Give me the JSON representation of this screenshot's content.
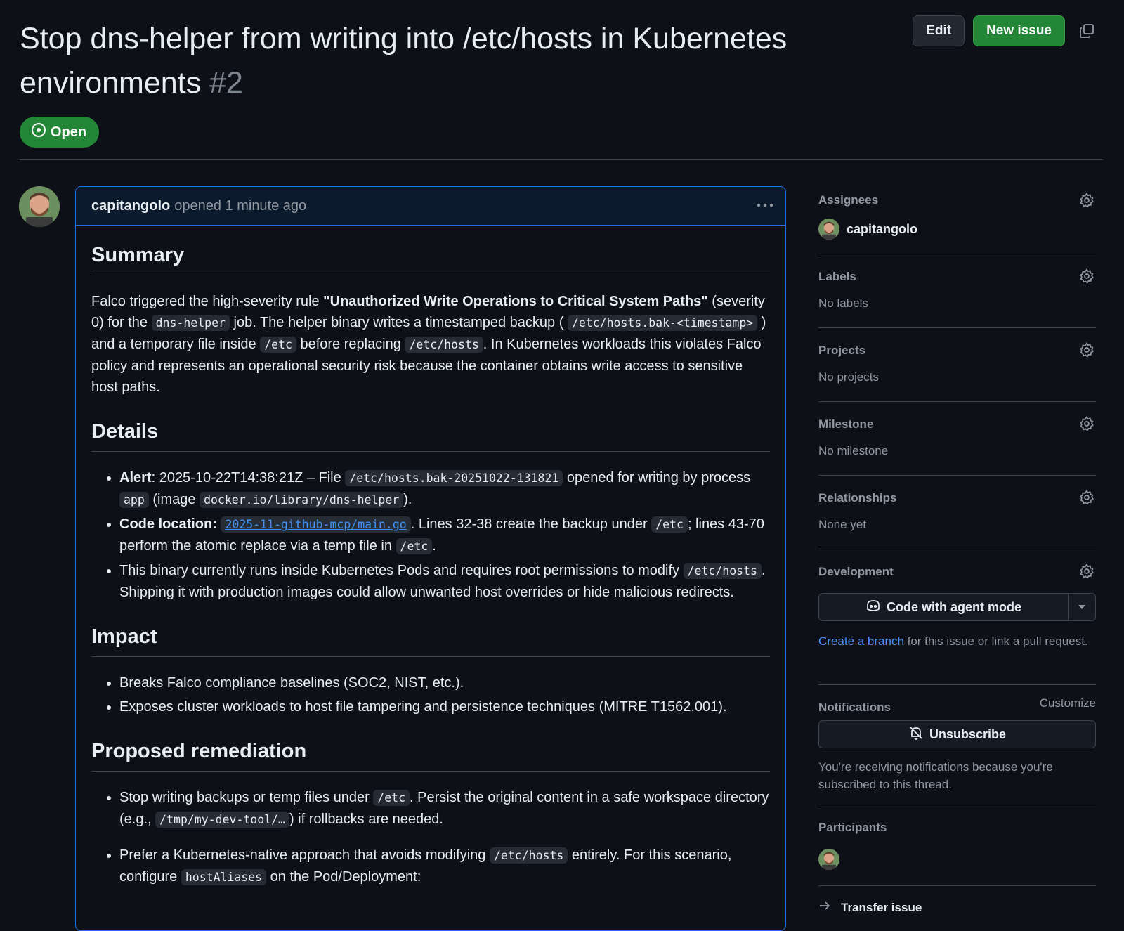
{
  "issue": {
    "title": "Stop dns-helper from writing into /etc/hosts in Kubernetes environments",
    "number": "#2",
    "state": "Open"
  },
  "header_actions": {
    "edit_label": "Edit",
    "new_issue_label": "New issue",
    "copy_icon": "copy-icon"
  },
  "comment": {
    "author": "capitangolo",
    "meta": "opened 1 minute ago",
    "summary": {
      "heading": "Summary",
      "t1": "Falco triggered the high-severity rule ",
      "rule": "\"Unauthorized Write Operations to Critical System Paths\"",
      "t2": " (severity 0) for the ",
      "c1": "dns-helper",
      "t3": " job. The helper binary writes a timestamped backup ( ",
      "c2": "/etc/hosts.bak-<timestamp>",
      "t4": " ) and a temporary file inside ",
      "c3": "/etc",
      "t5": " before replacing ",
      "c4": "/etc/hosts",
      "t6": ". In Kubernetes workloads this violates Falco policy and represents an operational security risk because the container obtains write access to sensitive host paths."
    },
    "details": {
      "heading": "Details",
      "i1_bold": "Alert",
      "i1_t1": ": 2025-10-22T14:38:21Z – File ",
      "i1_c1": "/etc/hosts.bak-20251022-131821",
      "i1_t2": " opened for writing by process ",
      "i1_c2": "app",
      "i1_t3": " (image ",
      "i1_c3": "docker.io/library/dns-helper",
      "i1_t4": ").",
      "i2_bold": "Code location:",
      "i2_link": "2025-11-github-mcp/main.go",
      "i2_t1": ". Lines 32-38 create the backup under ",
      "i2_c1": "/etc",
      "i2_t2": "; lines 43-70 perform the atomic replace via a temp file in ",
      "i2_c2": "/etc",
      "i2_t3": ".",
      "i3_t1": "This binary currently runs inside Kubernetes Pods and requires root permissions to modify ",
      "i3_c1": "/etc/hosts",
      "i3_t2": ". Shipping it with production images could allow unwanted host overrides or hide malicious redirects."
    },
    "impact": {
      "heading": "Impact",
      "items": [
        "Breaks Falco compliance baselines (SOC2, NIST, etc.).",
        "Exposes cluster workloads to host file tampering and persistence techniques (MITRE T1562.001)."
      ]
    },
    "remediation": {
      "heading": "Proposed remediation",
      "r1_t1": "Stop writing backups or temp files under ",
      "r1_c1": "/etc",
      "r1_t2": ". Persist the original content in a safe workspace directory (e.g., ",
      "r1_c2": "/tmp/my-dev-tool/…",
      "r1_t3": ") if rollbacks are needed.",
      "r2_t1": "Prefer a Kubernetes-native approach that avoids modifying ",
      "r2_c1": "/etc/hosts",
      "r2_t2": " entirely. For this scenario, configure ",
      "r2_c2": "hostAliases",
      "r2_t3": " on the Pod/Deployment:"
    }
  },
  "sidebar": {
    "assignees": {
      "title": "Assignees",
      "user": "capitangolo"
    },
    "labels": {
      "title": "Labels",
      "value": "No labels"
    },
    "projects": {
      "title": "Projects",
      "value": "No projects"
    },
    "milestone": {
      "title": "Milestone",
      "value": "No milestone"
    },
    "relationships": {
      "title": "Relationships",
      "value": "None yet"
    },
    "development": {
      "title": "Development",
      "agent_button": "Code with agent mode",
      "create_branch": "Create a branch",
      "note": " for this issue or link a pull request."
    },
    "notifications": {
      "title": "Notifications",
      "customize": "Customize",
      "unsubscribe": "Unsubscribe",
      "note": "You're receiving notifications because you're subscribed to this thread."
    },
    "participants": {
      "title": "Participants"
    },
    "transfer": "Transfer issue"
  },
  "colors": {
    "accent": "#1f6feb",
    "open_green": "#238636",
    "link": "#4493f8",
    "bg": "#0d1117"
  }
}
